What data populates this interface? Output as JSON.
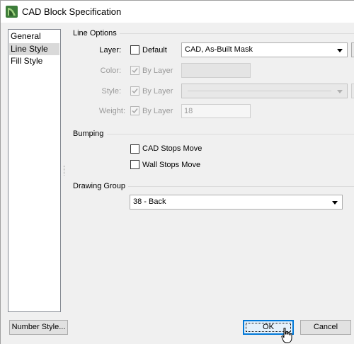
{
  "window": {
    "title": "CAD Block Specification",
    "app_icon": "app-icon"
  },
  "nav": {
    "items": [
      {
        "label": "General",
        "selected": false
      },
      {
        "label": "Line Style",
        "selected": true
      },
      {
        "label": "Fill Style",
        "selected": false
      }
    ]
  },
  "line_options": {
    "group_title": "Line Options",
    "layer": {
      "label": "Layer:",
      "checkbox_label": "Default",
      "checked": false,
      "value": "CAD, As-Built Mask"
    },
    "color": {
      "label": "Color:",
      "checkbox_label": "By Layer",
      "checked": true,
      "enabled": false
    },
    "style": {
      "label": "Style:",
      "checkbox_label": "By Layer",
      "checked": true,
      "enabled": false
    },
    "weight": {
      "label": "Weight:",
      "checkbox_label": "By Layer",
      "checked": true,
      "enabled": false,
      "value": "18"
    }
  },
  "bumping": {
    "group_title": "Bumping",
    "cad_stops_move": {
      "label": "CAD Stops Move",
      "checked": false
    },
    "wall_stops_move": {
      "label": "Wall Stops Move",
      "checked": false
    }
  },
  "drawing_group": {
    "group_title": "Drawing Group",
    "value": "38 - Back"
  },
  "footer": {
    "number_style_label": "Number Style...",
    "ok_label": "OK",
    "cancel_label": "Cancel"
  },
  "colors": {
    "accent": "#0078d7",
    "selected_item": "#d9d9d9",
    "dialog_bg": "#f0f0f0"
  }
}
